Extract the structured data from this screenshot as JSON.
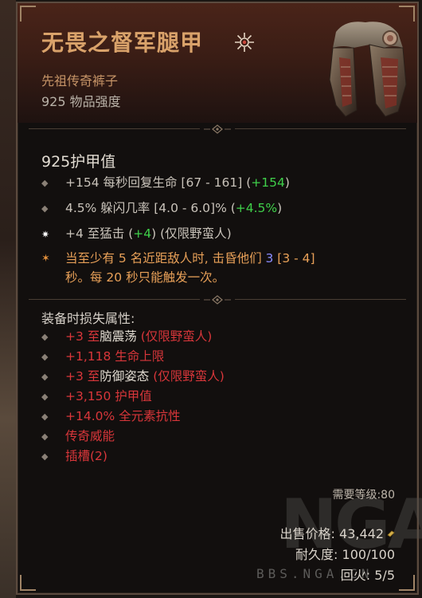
{
  "item": {
    "name": "无畏之督军腿甲",
    "type": "先祖传奇裤子",
    "power": "925 物品强度",
    "rarity_icon": "ancestral-star-icon",
    "image": "leg-armor-image"
  },
  "armor": "925护甲值",
  "affixes": [
    {
      "pre": "+154 每秒回复生命 [67 - 161] (",
      "value": "+154",
      "post": ")",
      "icon": "diamond-bullet-icon"
    },
    {
      "pre": "4.5% 躲闪几率 [4.0 - 6.0]% (",
      "value": "+4.5%",
      "post": ")",
      "icon": "diamond-bullet-icon"
    },
    {
      "pre": "+4 至猛击 (",
      "value": "+4",
      "post": ") (仅限野蛮人)",
      "icon": "star-bullet-icon"
    }
  ],
  "unique": {
    "icon": "unique-power-icon",
    "line1_pre": "当至少有 5 名近距敌人时, 击昏他们 ",
    "line1_value": "3",
    "line1_post": " [3 - 4]",
    "line2": "秒。每 20 秒只能触发一次。"
  },
  "lost_title": "装备时损失属性:",
  "lost": [
    {
      "pre": "+3 至",
      "mid": "脑震荡",
      "post": " (仅限野蛮人)"
    },
    {
      "pre": "+1,118 生命上限",
      "mid": "",
      "post": ""
    },
    {
      "pre": "+3 至",
      "mid": "防御姿态",
      "post": " (仅限野蛮人)"
    },
    {
      "pre": "+3,150 护甲值",
      "mid": "",
      "post": ""
    },
    {
      "pre": "+14.0% 全元素抗性",
      "mid": "",
      "post": ""
    },
    {
      "pre": "传奇威能",
      "mid": "",
      "post": ""
    },
    {
      "pre": "插槽(2)",
      "mid": "",
      "post": ""
    }
  ],
  "requirements": {
    "level_label": "需要等级:",
    "level": "80"
  },
  "sell": {
    "label": "出售价格:",
    "value": "43,442",
    "icon": "gold-coin-icon"
  },
  "durability": {
    "label": "耐久度:",
    "value": "100/100"
  },
  "charges": {
    "label": "回火:",
    "value": "5/5"
  },
  "watermark": {
    "logo": "NGA",
    "text": "BBS.NGA.CN"
  },
  "colors": {
    "name": "#d9a26a",
    "type": "#c69467",
    "green": "#3fd04a",
    "lost": "#d8363a",
    "unique": "#e8a058"
  }
}
